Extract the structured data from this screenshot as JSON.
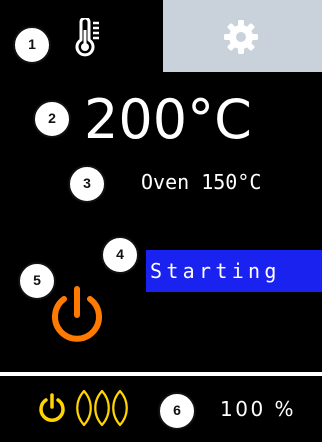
{
  "tabs": {
    "active": {
      "icon": "thermometer-icon"
    },
    "settings": {
      "icon": "gear-icon",
      "background": "#c9d2db"
    }
  },
  "main": {
    "temperature": "200°C",
    "oven_reading": "Oven 150°C",
    "status": "Starting",
    "status_background": "#1a22f0",
    "power_icon": "power-icon",
    "power_color": "#ff7a00"
  },
  "footer": {
    "power_icon": "power-icon",
    "heat_icon": "heating-element-icon",
    "icon_color": "#ffd400",
    "percent": "100 %"
  },
  "badges": [
    "1",
    "2",
    "3",
    "4",
    "5",
    "6"
  ]
}
